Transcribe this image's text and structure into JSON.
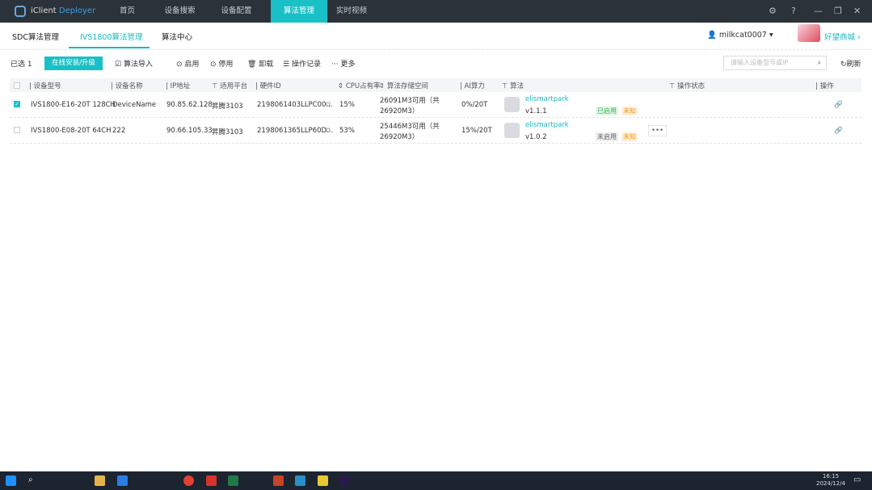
{
  "app": {
    "name_prefix": "iClient ",
    "name_suffix": "Deployer"
  },
  "nav": [
    "首页",
    "设备搜索",
    "设备配置",
    "算法管理",
    "实时视频"
  ],
  "window": {
    "settings_icon": "gear-icon",
    "help_icon": "help-icon"
  },
  "subtabs": [
    "SDC算法管理",
    "IVS1800算法管理",
    "算法中心"
  ],
  "user": {
    "name": "milkcat0007",
    "shop": "好望商城 ›"
  },
  "toolbar": {
    "selected_label": "已选",
    "selected_count": "1",
    "install": "在线安装/升级",
    "import": "算法导入",
    "enable": "启用",
    "disable": "停用",
    "uninstall": "卸载",
    "log": "操作记录",
    "more": "更多",
    "search_placeholder": "请输入设备型号或IP",
    "refresh": "刷新"
  },
  "columns": [
    "设备型号",
    "设备名称",
    "IP地址",
    "适用平台",
    "硬件ID",
    "CPU占有率",
    "算法存储空间",
    "AI算力",
    "算法",
    "操作状态",
    "操作"
  ],
  "rows": [
    {
      "checked": true,
      "model": "IVS1800-E16-20T 128CH",
      "name": "DeviceName",
      "ip": "90.85.62.128",
      "platform": "昇腾3103",
      "hwid": "2198061403LLPC00...",
      "cpu": "15%",
      "storage1": "26091M3可用（共",
      "storage2": "26920M3）",
      "ai": "0%/20T",
      "alg": "elismartpark",
      "ver": "v1.1.1",
      "status": "已启用",
      "state": "未知"
    },
    {
      "checked": false,
      "model": "IVS1800-E08-20T 64CH",
      "name": "222",
      "ip": "90.66.105.33",
      "platform": "昇腾3103",
      "hwid": "2198061365LLP60D...",
      "cpu": "53%",
      "storage1": "25446M3可用（共",
      "storage2": "26920M3）",
      "ai": "15%/20T",
      "alg": "elismartpark",
      "ver": "v1.0.2",
      "status": "未启用",
      "state": "未知",
      "more": "•••"
    }
  ],
  "clock": {
    "time": "16:15",
    "date": "2024/12/4"
  },
  "colors": {
    "accent": "#19c0c6",
    "topbar": "#2c3239"
  }
}
